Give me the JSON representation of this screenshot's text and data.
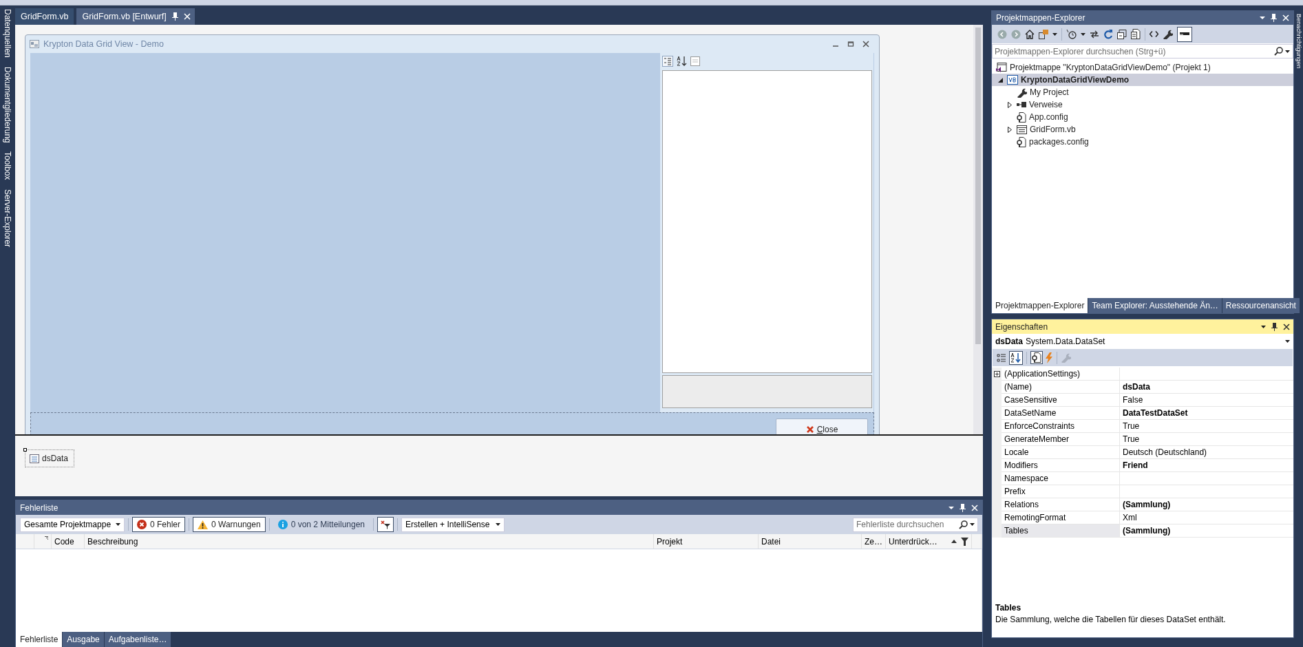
{
  "left_strip": {
    "tabs": [
      "Datenquellen",
      "Dokumentgliederung",
      "Toolbox",
      "Server-Explorer"
    ]
  },
  "document_tabs": [
    {
      "label": "GridForm.vb",
      "selected": false
    },
    {
      "label": "GridForm.vb [Entwurf]",
      "selected": true
    }
  ],
  "designer": {
    "form": {
      "title": "Krypton Data Grid View - Demo",
      "close_button": "Close"
    },
    "tray": [
      {
        "label": "dsData"
      }
    ]
  },
  "error_list": {
    "title": "Fehlerliste",
    "scope": "Gesamte Projektmappe",
    "filters": [
      {
        "kind": "error",
        "label": "0 Fehler",
        "selected": true
      },
      {
        "kind": "warning",
        "label": "0 Warnungen",
        "selected": true
      },
      {
        "kind": "info",
        "label": "0 von 2 Mitteilungen",
        "selected": false
      }
    ],
    "source": "Erstellen + IntelliSense",
    "search": {
      "placeholder": "Fehlerliste durchsuchen"
    },
    "columns": [
      "Code",
      "Beschreibung",
      "Projekt",
      "Datei",
      "Ze…",
      "Unterdrück…"
    ],
    "tabs": [
      {
        "label": "Fehlerliste",
        "selected": true
      },
      {
        "label": "Ausgabe",
        "selected": false
      },
      {
        "label": "Aufgabenliste…",
        "selected": false
      }
    ]
  },
  "solution_explorer": {
    "title": "Projektmappen-Explorer",
    "search": {
      "placeholder": "Projektmappen-Explorer durchsuchen (Strg+ü)"
    },
    "tree": [
      {
        "kind": "solution",
        "label": "Projektmappe \"KryptonDataGridViewDemo\" (Projekt 1)",
        "selected": false,
        "children": [
          {
            "kind": "project",
            "label": "KryptonDataGridViewDemo",
            "selected": true,
            "expanded": true,
            "children": [
              {
                "kind": "properties",
                "label": "My Project",
                "selected": false
              },
              {
                "kind": "references",
                "label": "Verweise",
                "selected": false,
                "expanded": false
              },
              {
                "kind": "config",
                "label": "App.config",
                "selected": false
              },
              {
                "kind": "form",
                "label": "GridForm.vb",
                "selected": false,
                "expanded": false
              },
              {
                "kind": "config",
                "label": "packages.config",
                "selected": false
              }
            ]
          }
        ]
      }
    ],
    "tabs": [
      {
        "label": "Projektmappen-Explorer",
        "selected": true
      },
      {
        "label": "Team Explorer: Ausstehende Än…",
        "selected": false
      },
      {
        "label": "Ressourcenansicht",
        "selected": false
      }
    ]
  },
  "properties": {
    "title": "Eigenschaften",
    "object_name": "dsData",
    "object_type": "System.Data.DataSet",
    "rows": [
      {
        "name": "(ApplicationSettings)",
        "value": "",
        "selected": false,
        "expanded": false
      },
      {
        "name": "(Name)",
        "value": "dsData",
        "modified": true,
        "selected": false
      },
      {
        "name": "CaseSensitive",
        "value": "False",
        "modified": false,
        "selected": false
      },
      {
        "name": "DataSetName",
        "value": "DataTestDataSet",
        "modified": true,
        "selected": false
      },
      {
        "name": "EnforceConstraints",
        "value": "True",
        "modified": false,
        "selected": false
      },
      {
        "name": "GenerateMember",
        "value": "True",
        "modified": false,
        "selected": false
      },
      {
        "name": "Locale",
        "value": "Deutsch (Deutschland)",
        "modified": false,
        "selected": false
      },
      {
        "name": "Modifiers",
        "value": "Friend",
        "modified": true,
        "selected": false
      },
      {
        "name": "Namespace",
        "value": "",
        "selected": false
      },
      {
        "name": "Prefix",
        "value": "",
        "selected": false
      },
      {
        "name": "Relations",
        "value": "(Sammlung)",
        "modified": true,
        "selected": false
      },
      {
        "name": "RemotingFormat",
        "value": "Xml",
        "modified": false,
        "selected": false
      },
      {
        "name": "Tables",
        "value": "(Sammlung)",
        "modified": true,
        "selected": true
      }
    ],
    "description": {
      "title": "Tables",
      "text": "Die Sammlung, welche die Tabellen für dieses DataSet enthält."
    }
  },
  "right_strip": {
    "tabs": [
      "Benachrichtigungen"
    ]
  }
}
